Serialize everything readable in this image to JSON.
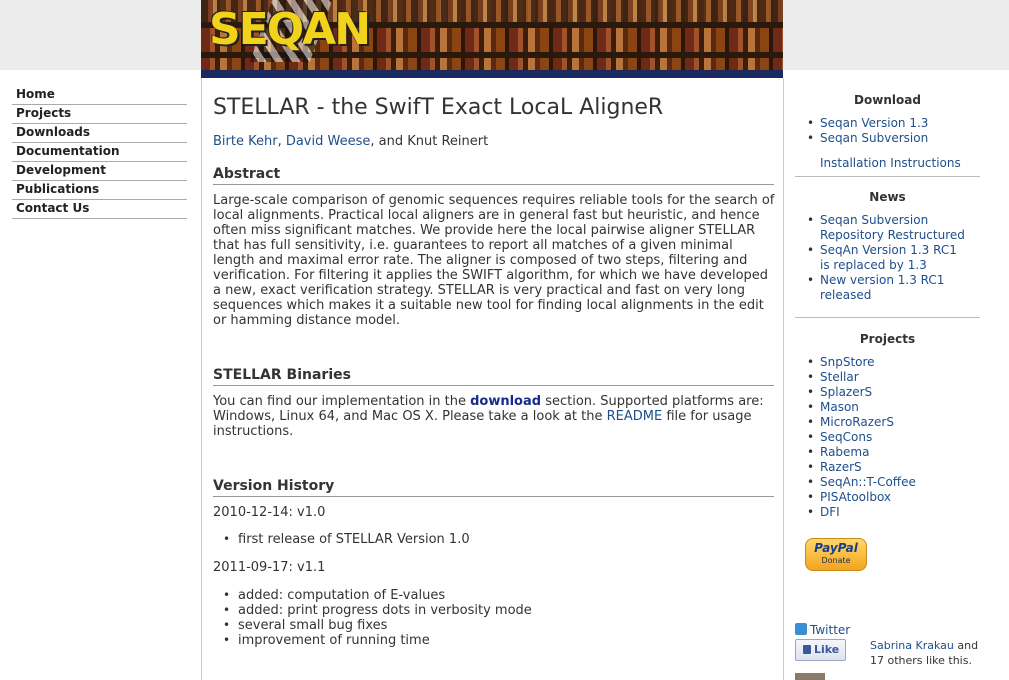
{
  "header": {
    "logo_text": "SEQAN"
  },
  "nav": {
    "items": [
      {
        "label": "Home"
      },
      {
        "label": "Projects"
      },
      {
        "label": "Downloads"
      },
      {
        "label": "Documentation"
      },
      {
        "label": "Development"
      },
      {
        "label": "Publications"
      },
      {
        "label": "Contact Us"
      }
    ]
  },
  "main": {
    "title": "STELLAR - the SwifT Exact LocaL AligneR",
    "authors": {
      "a1": "Birte Kehr",
      "sep1": ", ",
      "a2": "David Weese",
      "sep2": ", and Knut Reinert"
    },
    "abstract_heading": "Abstract",
    "abstract_text": "Large-scale comparison of genomic sequences requires reliable tools for the search of local alignments. Practical local aligners are in general fast but heuristic, and hence often miss significant matches. We provide here the local pairwise aligner STELLAR that has full sensitivity, i.e. guarantees to report all matches of a given minimal length and maximal error rate. The aligner is composed of two steps, filtering and verification. For filtering it applies the SWIFT algorithm, for which we have developed a new, exact verification strategy. STELLAR is very practical and fast on very long sequences which makes it a suitable new tool for finding local alignments in the edit or hamming distance model.",
    "binaries_heading": "STELLAR Binaries",
    "binaries": {
      "t1": "You can find our implementation in the ",
      "link_download": "download",
      "t2": " section. Supported platforms are: Windows, Linux 64, and Mac OS X. Please take a look at the ",
      "link_readme": "README",
      "t3": " file for usage instructions."
    },
    "history_heading": "Version History",
    "versions": [
      {
        "label": "2010-12-14: v1.0",
        "items": [
          "first release of STELLAR Version 1.0"
        ]
      },
      {
        "label": "2011-09-17: v1.1",
        "items": [
          "added: computation of E-values",
          "added: print progress dots in verbosity mode",
          "several small bug fixes",
          "improvement of running time"
        ]
      }
    ]
  },
  "sidebar": {
    "download_heading": "Download",
    "download_links": [
      "Seqan Version 1.3",
      "Seqan Subversion"
    ],
    "install_link": "Installation Instructions",
    "news_heading": "News",
    "news_links": [
      "Seqan Subversion Repository Restructured",
      "SeqAn Version 1.3 RC1 is replaced by 1.3",
      "New version 1.3 RC1 released"
    ],
    "projects_heading": "Projects",
    "project_links": [
      "SnpStore",
      "Stellar",
      "SplazerS",
      "Mason",
      "MicroRazerS",
      "SeqCons",
      "Rabema",
      "RazerS",
      "SeqAn::T-Coffee",
      "PISAtoolbox",
      "DFI"
    ],
    "paypal": {
      "brand": "PayPal",
      "label": "Donate"
    },
    "twitter_label": "Twitter",
    "like_label": "Like",
    "like_name": "Sabrina Krakau",
    "like_rest": " and 17 others like this."
  },
  "colors": {
    "link": "#1f4e8c",
    "nav_blue": "#1a2a5e",
    "logo_yellow": "#f2d21a"
  }
}
